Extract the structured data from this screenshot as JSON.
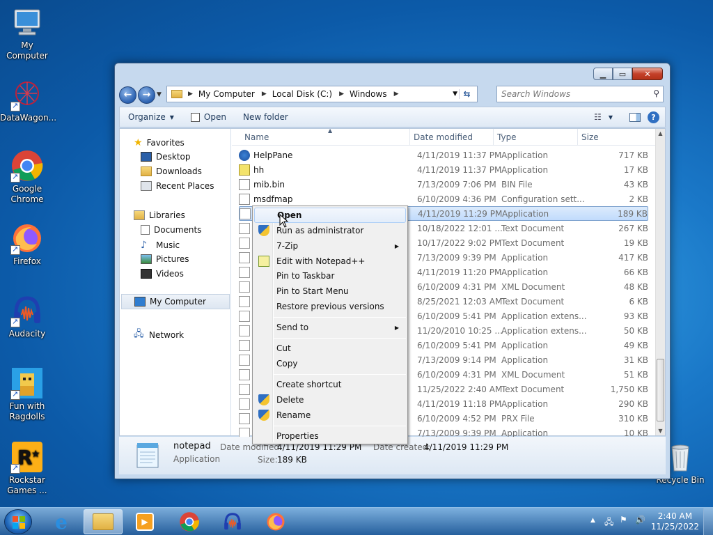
{
  "desktop": {
    "icons": [
      {
        "label": "My Computer"
      },
      {
        "label": "DataWagon..."
      },
      {
        "label": "Google Chrome"
      },
      {
        "label": "Firefox"
      },
      {
        "label": "Audacity"
      },
      {
        "label": "Fun with Ragdolls"
      },
      {
        "label": "Rockstar Games ..."
      },
      {
        "label": "Recycle Bin"
      }
    ]
  },
  "window": {
    "address": {
      "segments": [
        "My Computer",
        "Local Disk (C:)",
        "Windows"
      ]
    },
    "search": {
      "placeholder": "Search Windows"
    },
    "toolbar": {
      "organize": "Organize",
      "open": "Open",
      "new_folder": "New folder"
    },
    "nav": {
      "favorites": "Favorites",
      "desktop": "Desktop",
      "downloads": "Downloads",
      "recent": "Recent Places",
      "libraries": "Libraries",
      "documents": "Documents",
      "music": "Music",
      "pictures": "Pictures",
      "videos": "Videos",
      "my_computer": "My Computer",
      "network": "Network"
    },
    "columns": {
      "name": "Name",
      "date": "Date modified",
      "type": "Type",
      "size": "Size"
    },
    "files": [
      {
        "name": "HelpPane",
        "date": "4/11/2019 11:37 PM",
        "type": "Application",
        "size": "717 KB"
      },
      {
        "name": "hh",
        "date": "4/11/2019 11:37 PM",
        "type": "Application",
        "size": "17 KB"
      },
      {
        "name": "mib.bin",
        "date": "7/13/2009 7:06 PM",
        "type": "BIN File",
        "size": "43 KB"
      },
      {
        "name": "msdfmap",
        "date": "6/10/2009 4:36 PM",
        "type": "Configuration sett...",
        "size": "2 KB"
      },
      {
        "name": "",
        "date": "4/11/2019 11:29 PM",
        "type": "Application",
        "size": "189 KB"
      },
      {
        "name": "",
        "date": "10/18/2022 12:01 ...",
        "type": "Text Document",
        "size": "267 KB"
      },
      {
        "name": "",
        "date": "10/17/2022 9:02 PM",
        "type": "Text Document",
        "size": "19 KB"
      },
      {
        "name": "",
        "date": "7/13/2009 9:39 PM",
        "type": "Application",
        "size": "417 KB"
      },
      {
        "name": "",
        "date": "4/11/2019 11:20 PM",
        "type": "Application",
        "size": "66 KB"
      },
      {
        "name": "",
        "date": "6/10/2009 4:31 PM",
        "type": "XML Document",
        "size": "48 KB"
      },
      {
        "name": "",
        "date": "8/25/2021 12:03 AM",
        "type": "Text Document",
        "size": "6 KB"
      },
      {
        "name": "",
        "date": "6/10/2009 5:41 PM",
        "type": "Application extens...",
        "size": "93 KB"
      },
      {
        "name": "",
        "date": "11/20/2010 10:25 ...",
        "type": "Application extens...",
        "size": "50 KB"
      },
      {
        "name": "",
        "date": "6/10/2009 5:41 PM",
        "type": "Application",
        "size": "49 KB"
      },
      {
        "name": "",
        "date": "7/13/2009 9:14 PM",
        "type": "Application",
        "size": "31 KB"
      },
      {
        "name": "",
        "date": "6/10/2009 4:31 PM",
        "type": "XML Document",
        "size": "51 KB"
      },
      {
        "name": "",
        "date": "11/25/2022 2:40 AM",
        "type": "Text Document",
        "size": "1,750 KB"
      },
      {
        "name": "",
        "date": "4/11/2019 11:18 PM",
        "type": "Application",
        "size": "290 KB"
      },
      {
        "name": "",
        "date": "6/10/2009 4:52 PM",
        "type": "PRX File",
        "size": "310 KB"
      },
      {
        "name": "",
        "date": "7/13/2009 9:39 PM",
        "type": "Application",
        "size": "10 KB"
      }
    ],
    "details": {
      "name": "notepad",
      "kind": "Application",
      "modified_label": "Date modified:",
      "modified": "4/11/2019 11:29 PM",
      "created_label": "Date created:",
      "created": "4/11/2019 11:29 PM",
      "size_label": "Size:",
      "size": "189 KB"
    }
  },
  "context_menu": {
    "items": [
      "Open",
      "Run as administrator",
      "7-Zip",
      "Edit with Notepad++",
      "Pin to Taskbar",
      "Pin to Start Menu",
      "Restore previous versions",
      "Send to",
      "Cut",
      "Copy",
      "Create shortcut",
      "Delete",
      "Rename",
      "Properties"
    ]
  },
  "taskbar": {
    "time": "2:40 AM",
    "date": "11/25/2022"
  },
  "colors": {
    "accent": "#1a78c8",
    "selection": "#c1dbfc"
  }
}
